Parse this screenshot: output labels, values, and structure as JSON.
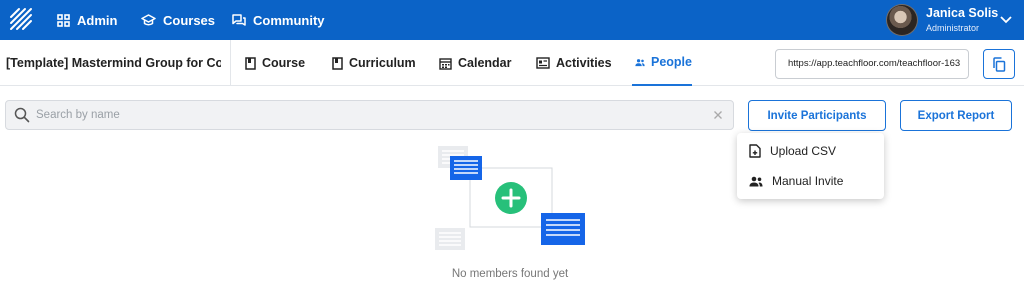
{
  "topnav": {
    "admin": "Admin",
    "courses": "Courses",
    "community": "Community"
  },
  "user": {
    "name": "Janica Solis",
    "role": "Administrator"
  },
  "course": {
    "title": "[Template] Mastermind Group for Co..."
  },
  "tabs": {
    "course": "Course",
    "curriculum": "Curriculum",
    "calendar": "Calendar",
    "activities": "Activities",
    "people": "People"
  },
  "active_tab": "people",
  "share": {
    "url": "https://app.teachfloor.com/teachfloor-163"
  },
  "search": {
    "placeholder": "Search by name",
    "value": ""
  },
  "actions": {
    "invite": "Invite Participants",
    "export": "Export Report"
  },
  "invite_menu": {
    "upload_csv": "Upload CSV",
    "manual_invite": "Manual Invite"
  },
  "empty_state": {
    "message": "No members found yet"
  },
  "colors": {
    "brand_blue": "#0b63c7",
    "accent_blue": "#1a73d9",
    "doc_blue": "#1565e8",
    "plus_green": "#27c07a"
  },
  "icons": {
    "logo": "striped-logo-icon",
    "admin": "grid-icon",
    "courses": "graduation-cap-icon",
    "community": "chat-bubbles-icon",
    "user_menu": "chevron-down-icon",
    "course_tab": "book-icon",
    "curriculum_tab": "book-icon",
    "calendar_tab": "calendar-icon",
    "activities_tab": "activity-card-icon",
    "people_tab": "people-icon",
    "copy": "copy-icon",
    "search": "search-icon",
    "clear": "close-icon",
    "upload_csv": "file-upload-icon",
    "manual_invite": "people-icon"
  }
}
